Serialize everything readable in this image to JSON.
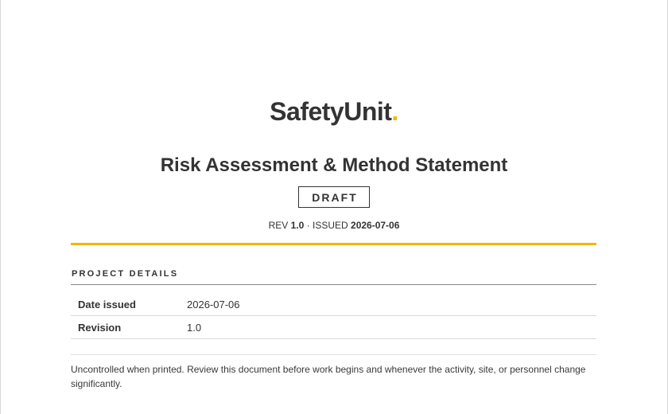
{
  "brand": {
    "name": "SafetyUnit",
    "dot": ".",
    "accent": "#f2b705"
  },
  "document": {
    "title": "Risk Assessment & Method Statement",
    "status": "DRAFT",
    "rev_label": "REV",
    "rev_value": "1.0",
    "separator": "·",
    "issued_label": "ISSUED",
    "issued_value": "2026-07-06"
  },
  "project_details": {
    "heading": "PROJECT DETAILS",
    "rows": [
      {
        "label": "Date issued",
        "value": "2026-07-06"
      },
      {
        "label": "Revision",
        "value": "1.0"
      }
    ]
  },
  "notice": "Uncontrolled when printed. Review this document before work begins and whenever the activity, site, or personnel change significantly."
}
